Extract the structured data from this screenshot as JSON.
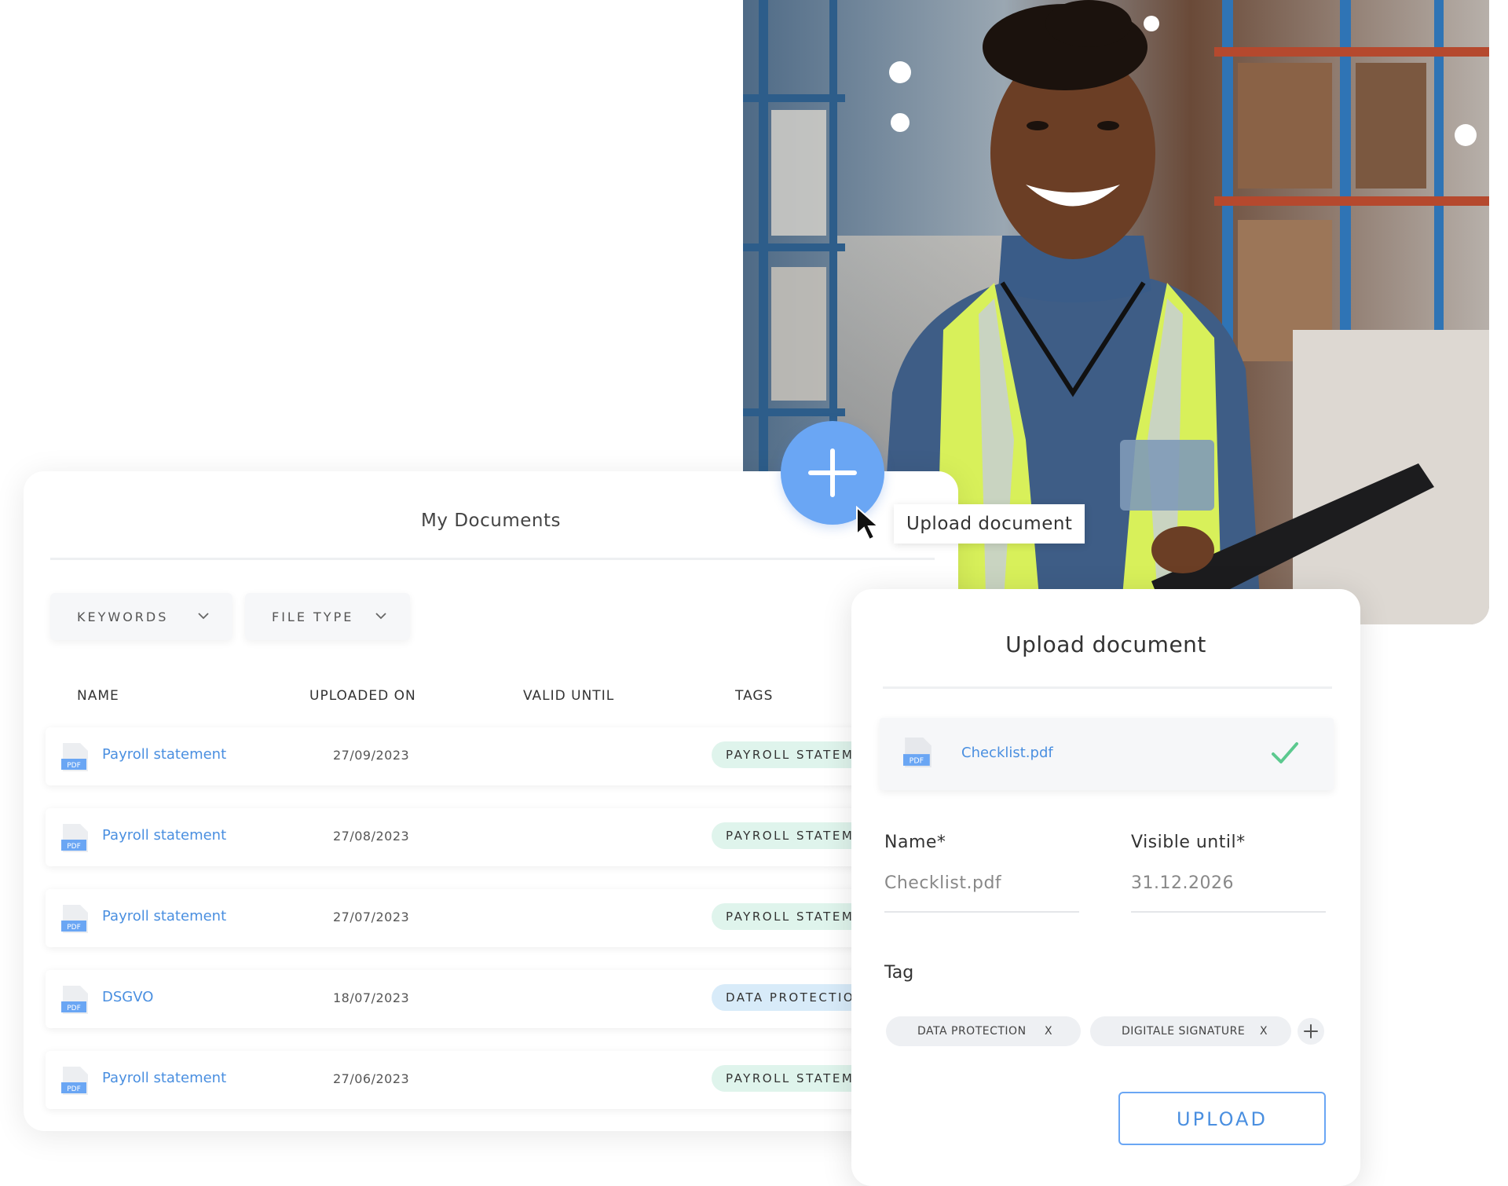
{
  "docs": {
    "title": "My Documents",
    "filters": [
      {
        "label": "KEYWORDS"
      },
      {
        "label": "FILE TYPE"
      }
    ],
    "columns": [
      "NAME",
      "UPLOADED ON",
      "VALID UNTIL",
      "TAGS"
    ],
    "rows": [
      {
        "name": "Payroll statement",
        "uploaded": "27/09/2023",
        "tag": "PAYROLL STATEMEN"
      },
      {
        "name": "Payroll statement",
        "uploaded": "27/08/2023",
        "tag": "PAYROLL STATEMEN"
      },
      {
        "name": "Payroll statement",
        "uploaded": "27/07/2023",
        "tag": "PAYROLL STATEMEN"
      },
      {
        "name": "DSGVO",
        "uploaded": "18/07/2023",
        "tag": "DATA PROTECTION"
      },
      {
        "name": "Payroll statement",
        "uploaded": "27/06/2023",
        "tag": "PAYROLL STATEMEN"
      }
    ]
  },
  "tooltip": "Upload document",
  "upload": {
    "title": "Upload document",
    "file_name": "Checklist.pdf",
    "name_label": "Name*",
    "name_value": "Checklist.pdf",
    "visible_label": "Visible until*",
    "visible_value": "31.12.2026",
    "tag_label": "Tag",
    "chips": [
      {
        "label": "DATA PROTECTION",
        "remove": "X"
      },
      {
        "label": "DIGITALE SIGNATURE",
        "remove": "X"
      }
    ],
    "button_label": "UPLOAD"
  },
  "icons": {
    "pdf_badge": "PDF",
    "add": "plus-icon",
    "check": "checkmark-icon",
    "cursor": "mouse-pointer-icon",
    "chevron": "chevron-down-icon"
  },
  "colors": {
    "accent": "#6aa6f4",
    "link": "#4a8fe0",
    "tag_green": "#dff4ec",
    "tag_blue": "#d8ebf9",
    "success": "#5cc98f"
  }
}
